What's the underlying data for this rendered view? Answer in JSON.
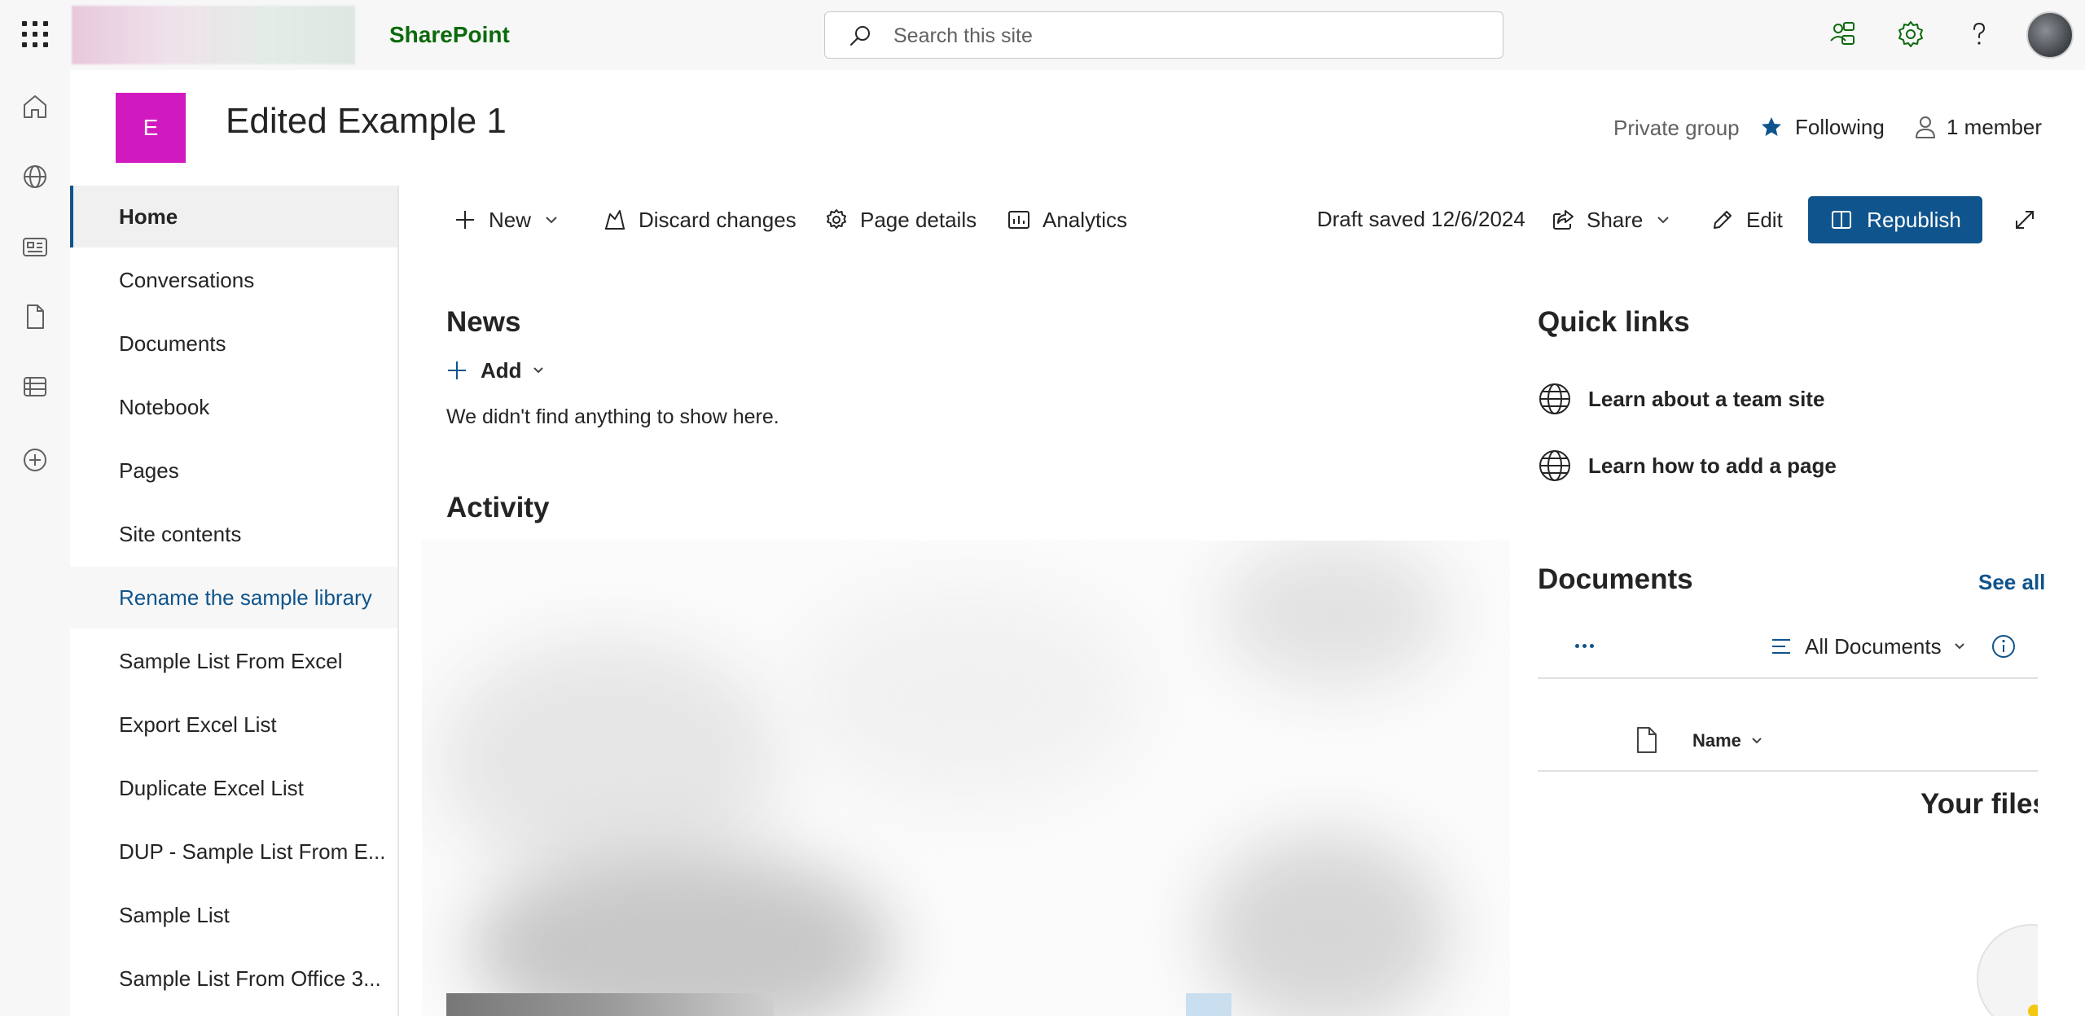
{
  "suitebar": {
    "app_name": "SharePoint",
    "search_placeholder": "Search this site"
  },
  "site": {
    "tile_letter": "E",
    "tile_color": "#d01ac0",
    "title": "Edited Example 1",
    "privacy": "Private group",
    "following_label": "Following",
    "members_label": "1 member"
  },
  "leftnav": {
    "items": [
      {
        "label": "Home",
        "state": "selected"
      },
      {
        "label": "Conversations"
      },
      {
        "label": "Documents"
      },
      {
        "label": "Notebook"
      },
      {
        "label": "Pages"
      },
      {
        "label": "Site contents"
      },
      {
        "label": "Rename the sample library",
        "state": "hover"
      },
      {
        "label": "Sample List From Excel"
      },
      {
        "label": "Export Excel List"
      },
      {
        "label": "Duplicate Excel List"
      },
      {
        "label": "DUP - Sample List From E..."
      },
      {
        "label": "Sample List"
      },
      {
        "label": "Sample List From Office 3..."
      }
    ]
  },
  "commandbar": {
    "new_label": "New",
    "discard_label": "Discard changes",
    "page_details_label": "Page details",
    "analytics_label": "Analytics",
    "draft_status": "Draft saved 12/6/2024",
    "share_label": "Share",
    "edit_label": "Edit",
    "republish_label": "Republish"
  },
  "news": {
    "title": "News",
    "add_label": "Add",
    "empty_message": "We didn't find anything to show here."
  },
  "activity": {
    "title": "Activity"
  },
  "quicklinks": {
    "title": "Quick links",
    "links": [
      {
        "label": "Learn about a team site",
        "icon": "globe-icon"
      },
      {
        "label": "Learn how to add a page",
        "icon": "globe-icon"
      }
    ]
  },
  "documents": {
    "title": "Documents",
    "see_all_label": "See all",
    "view_label": "All Documents",
    "name_column": "Name",
    "empty_heading": "Your files"
  },
  "colors": {
    "brand_blue": "#0f548c",
    "sharepoint_green": "#0b6a0b"
  }
}
